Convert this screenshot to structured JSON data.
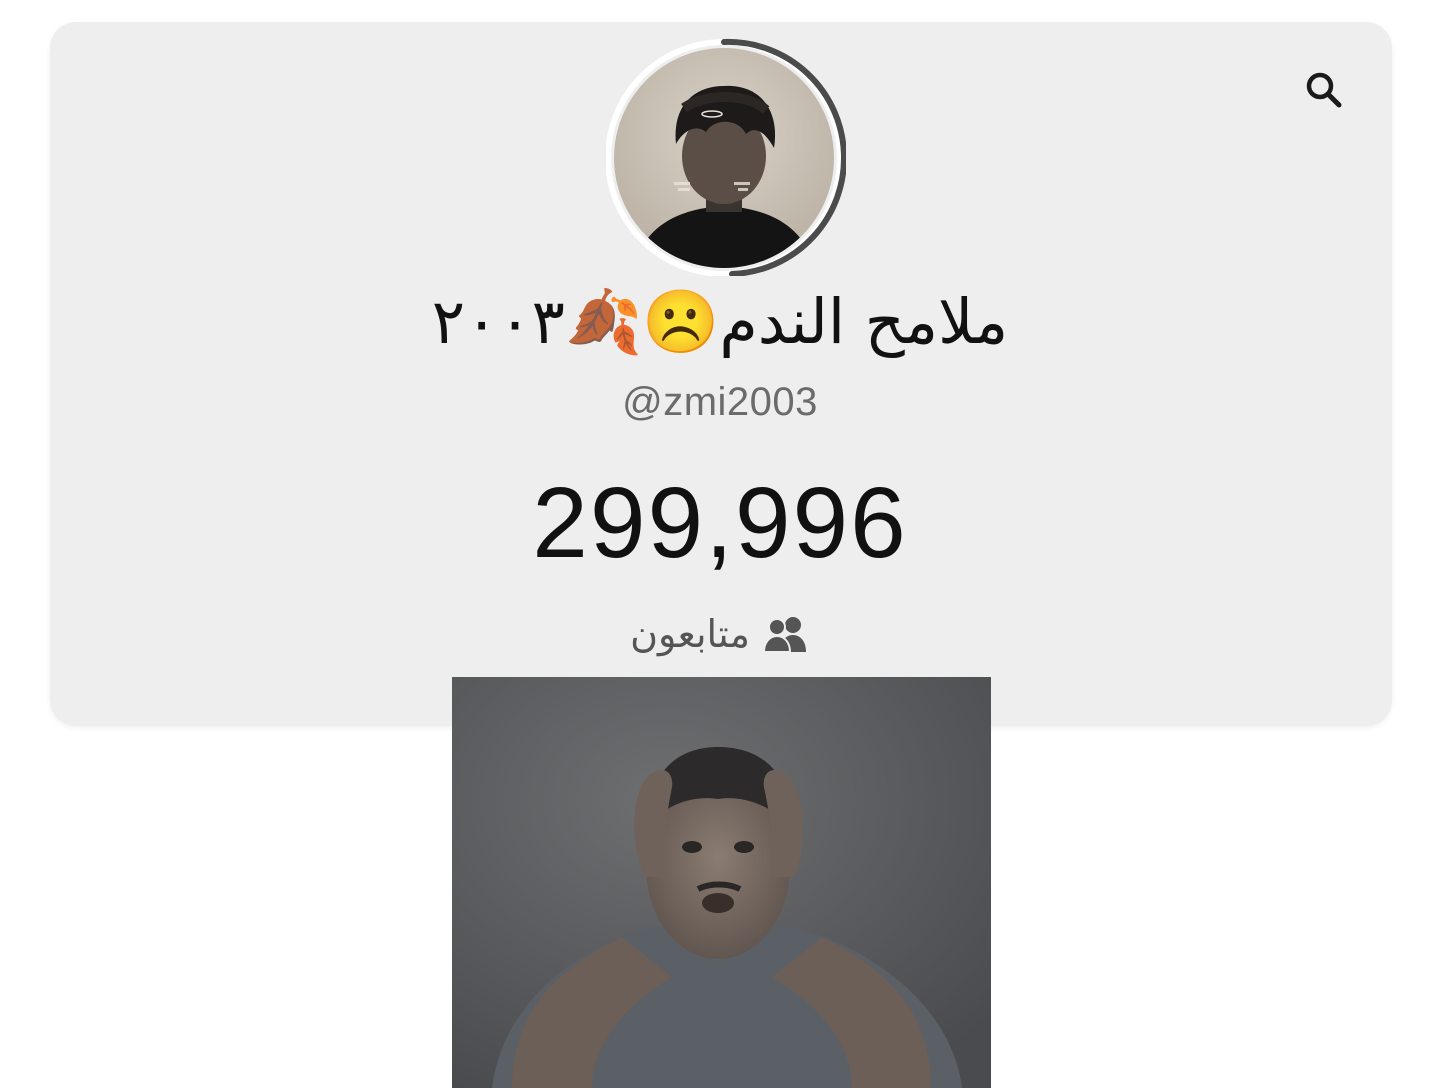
{
  "profile": {
    "display_name": "ملامح الندم☹️🍂٢٠٠٣",
    "username": "@zmi2003",
    "followers_count": "299,996",
    "followers_label": "متابعون"
  },
  "icons": {
    "search": "search-icon",
    "followers": "people-icon"
  },
  "colors": {
    "card_bg": "#eeeeee",
    "page_bg": "#ffffff",
    "text_primary": "#111111",
    "text_secondary": "#6b6b6b",
    "ring": "#555555"
  }
}
